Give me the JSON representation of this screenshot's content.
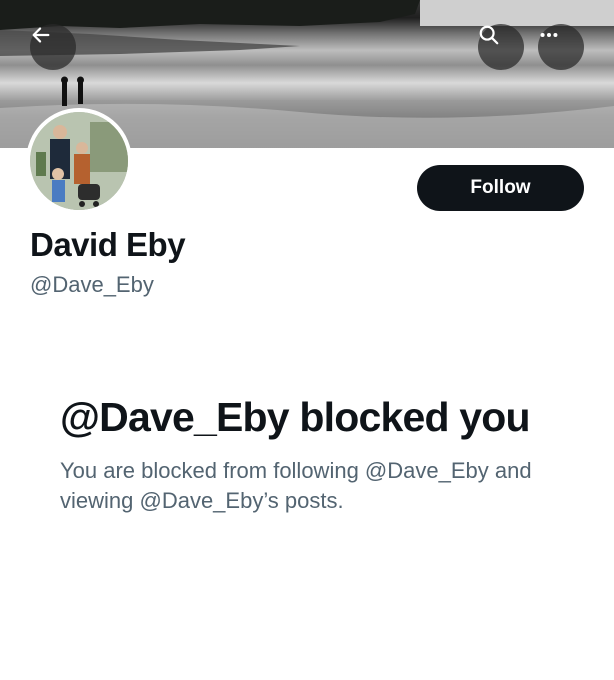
{
  "header": {
    "back_icon": "arrow-left-icon",
    "search_icon": "search-icon",
    "more_icon": "more-horizontal-icon"
  },
  "profile": {
    "display_name": "David Eby",
    "handle": "@Dave_Eby",
    "follow_label": "Follow"
  },
  "blocked_notice": {
    "title": "@Dave_Eby blocked you",
    "description": "You are blocked from following @Dave_Eby and viewing @Dave_Eby’s posts."
  },
  "colors": {
    "text_primary": "#0f1419",
    "text_secondary": "#536471",
    "button_bg": "#0f1419",
    "button_text": "#ffffff"
  }
}
